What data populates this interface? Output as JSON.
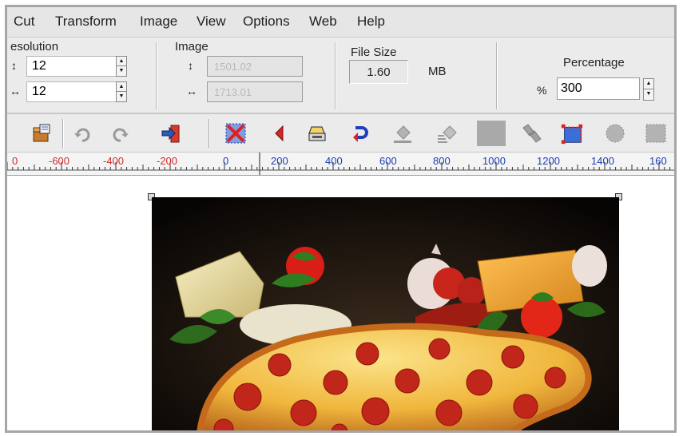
{
  "menu": [
    "Cut",
    "Transform",
    "Image",
    "View",
    "Options",
    "Web",
    "Help"
  ],
  "resolution": {
    "label": "esolution",
    "height_value": "12",
    "width_value": "12"
  },
  "image": {
    "label": "Image",
    "height_value": "1501.02",
    "width_value": "1713.01"
  },
  "file_size": {
    "label": "File Size",
    "value": "1.60",
    "unit": "MB"
  },
  "percentage": {
    "label": "Percentage",
    "symbol": "%",
    "value": "300"
  },
  "toolbar": {
    "icons": [
      "package-icon",
      "undo-icon",
      "redo-icon",
      "exit-icon",
      "delete-icon",
      "back-icon",
      "scanner-icon",
      "rotate-icon",
      "fill-icon",
      "fill-alt-icon",
      "solid-square-icon",
      "pattern-icon",
      "crop-icon",
      "circle-icon",
      "square-icon"
    ]
  },
  "ruler": {
    "negative_labels": [
      "0",
      "-600",
      "-400",
      "-200"
    ],
    "positive_labels": [
      "0",
      "200",
      "400",
      "600",
      "800",
      "1000",
      "1200",
      "1400",
      "160"
    ]
  },
  "colors": {
    "ruler_negative": "#d22b2b",
    "ruler_positive": "#1d3fb3",
    "chrome": "#ebebeb"
  }
}
